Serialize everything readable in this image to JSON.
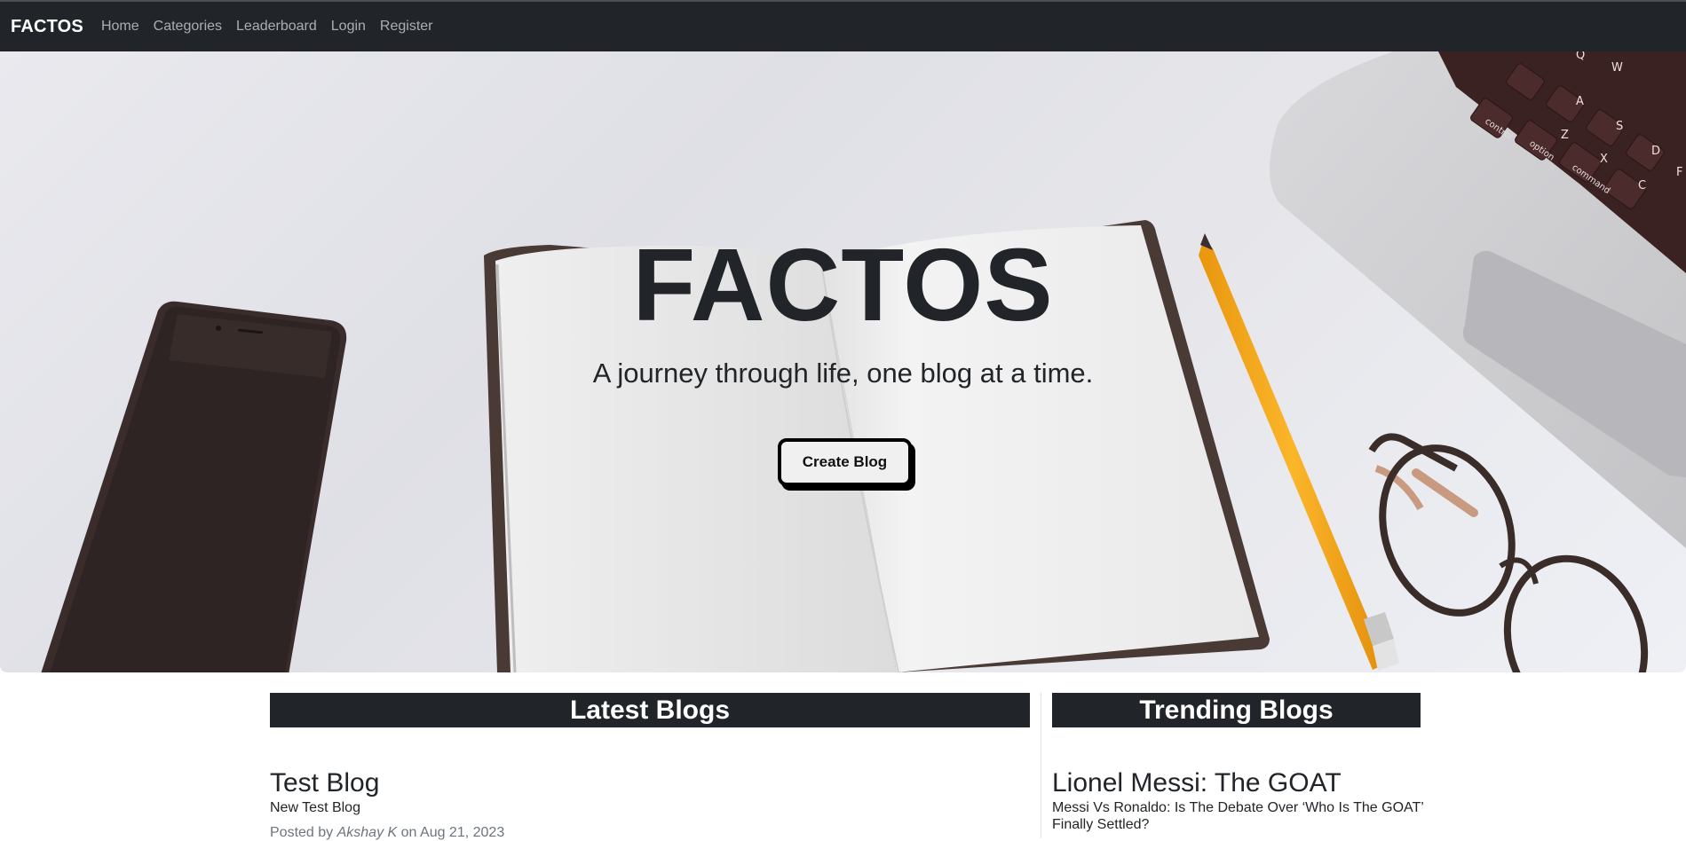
{
  "navbar": {
    "brand": "FACTOS",
    "links": [
      "Home",
      "Categories",
      "Leaderboard",
      "Login",
      "Register"
    ]
  },
  "hero": {
    "title": "FACTOS",
    "tagline": "A journey through life, one blog at a time.",
    "cta_label": "Create Blog",
    "key_labels": [
      "control",
      "option",
      "command",
      "A",
      "S",
      "D",
      "F",
      "Z",
      "X",
      "C",
      "W",
      "Q"
    ]
  },
  "latest": {
    "heading": "Latest Blogs",
    "posts": [
      {
        "title": "Test Blog",
        "subtitle": "New Test Blog",
        "posted_by_prefix": "Posted by",
        "author": "Akshay K",
        "on_text": "on Aug 21, 2023"
      }
    ]
  },
  "trending": {
    "heading": "Trending Blogs",
    "posts": [
      {
        "title": "Lionel Messi: The GOAT",
        "subtitle": "Messi Vs Ronaldo: Is The Debate Over ‘Who Is The GOAT’ Finally Settled?"
      }
    ]
  },
  "colors": {
    "navbar_bg": "#212529",
    "section_header_bg": "#212529",
    "hero_bg": "#e4e5ea",
    "pencil": "#f5a81c"
  }
}
